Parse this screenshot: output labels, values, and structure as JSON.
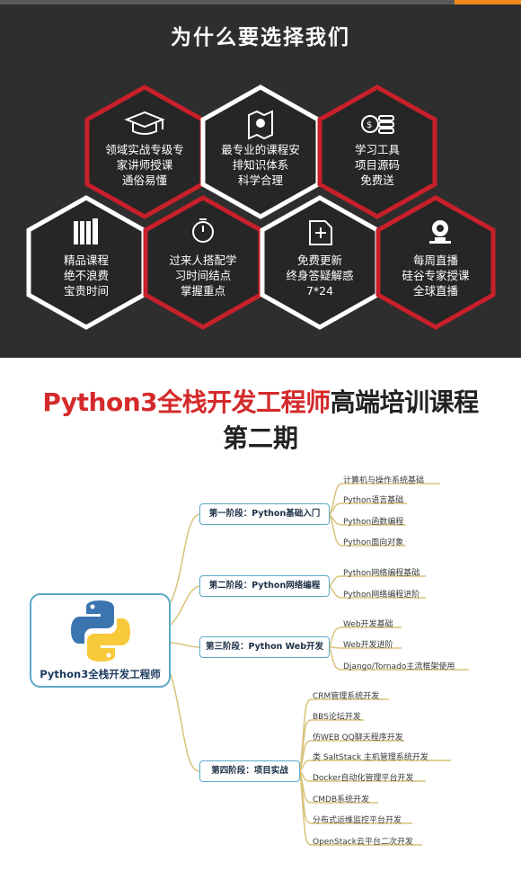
{
  "header": {
    "title": "为什么要选择我们"
  },
  "features": [
    {
      "icon": "graduation-cap-icon",
      "lines": [
        "领域实战专级专",
        "家讲师授课",
        "通俗易懂"
      ],
      "style": "red"
    },
    {
      "icon": "map-pin-icon",
      "lines": [
        "最专业的课程安",
        "排知识体系",
        "科学合理"
      ],
      "style": "white"
    },
    {
      "icon": "coins-icon",
      "lines": [
        "学习工具",
        "项目源码",
        "免费送"
      ],
      "style": "red"
    },
    {
      "icon": "books-icon",
      "lines": [
        "精品课程",
        "绝不浪费",
        "宝贵时间"
      ],
      "style": "white"
    },
    {
      "icon": "stopwatch-icon",
      "lines": [
        "过来人搭配学",
        "习时间结点",
        "掌握重点"
      ],
      "style": "red"
    },
    {
      "icon": "document-plus-icon",
      "lines": [
        "免费更新",
        "终身答疑解惑",
        "7*24"
      ],
      "style": "white"
    },
    {
      "icon": "live-camera-icon",
      "lines": [
        "每周直播",
        "硅谷专家授课",
        "全球直播"
      ],
      "style": "red"
    }
  ],
  "course": {
    "title_red": "Python3全栈开发工程师",
    "title_black": "高端培训课程",
    "subtitle": "第二期"
  },
  "mindmap": {
    "root": "Python3全栈开发工程师",
    "stages": [
      {
        "label": "第一阶段：Python基础入门",
        "items": [
          "计算机与操作系统基础",
          "Python语言基础",
          "Python函数编程",
          "Python面向对象"
        ]
      },
      {
        "label": "第二阶段：Python网络编程",
        "items": [
          "Python网络编程基础",
          "Python网络编程进阶"
        ]
      },
      {
        "label": "第三阶段：Python Web开发",
        "items": [
          "Web开发基础",
          "Web开发进阶",
          "Django/Tornado主流框架使用"
        ]
      },
      {
        "label": "第四阶段：项目实战",
        "items": [
          "CRM管理系统开发",
          "BBS论坛开发",
          "仿WEB QQ聊天程序开发",
          "类 SaltStack 主机管理系统开发",
          "Docker自动化管理平台开发",
          "CMDB系统开发",
          "分布式运维监控平台开发",
          "OpenStack云平台二次开发"
        ]
      }
    ]
  },
  "colors": {
    "dark_bg": "#2e2e2e",
    "hex_red_border": "#c8202a",
    "hex_white_border": "#ffffff",
    "accent_orange": "#f08a1c",
    "title_red": "#d42a2a",
    "mindmap_line": "#d9c27a",
    "stage_border": "#5aa9c9",
    "python_blue": "#3a75b0",
    "python_yellow": "#f7c93b"
  }
}
